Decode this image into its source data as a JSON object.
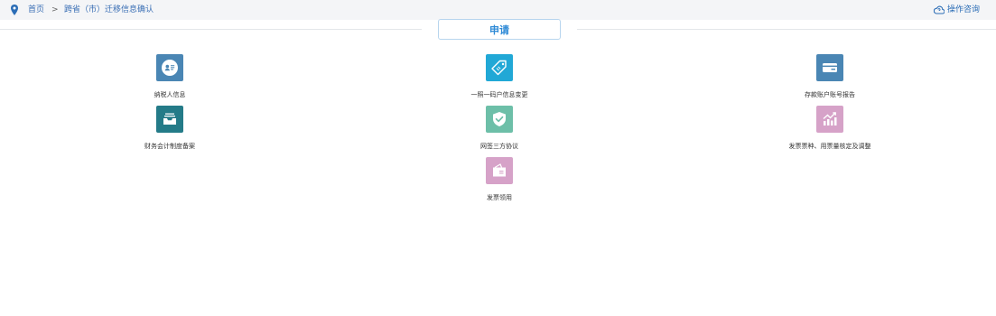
{
  "breadcrumb": {
    "home": "首页",
    "separator": ">",
    "current": "跨省（市）迁移信息确认"
  },
  "help": {
    "label": "操作咨询"
  },
  "section": {
    "title": "申请"
  },
  "tiles": [
    {
      "label": "纳税人信息",
      "icon": "id-card-icon",
      "color": "#4a86b4"
    },
    {
      "label": "一照一码户信息变更",
      "icon": "tag-icon",
      "color": "#21a8d6"
    },
    {
      "label": "存款账户账号报告",
      "icon": "card-icon",
      "color": "#4a86b4"
    },
    {
      "label": "财务会计制度备案",
      "icon": "inbox-icon",
      "color": "#247b88"
    },
    {
      "label": "网签三方协议",
      "icon": "shield-check-icon",
      "color": "#6dbfa8"
    },
    {
      "label": "发票票种、用票量核定及调整",
      "icon": "chart-up-icon",
      "color": "#d6a2c8"
    },
    {
      "label": "发票领用",
      "icon": "receipt-icon",
      "color": "#d6a2c8"
    }
  ]
}
